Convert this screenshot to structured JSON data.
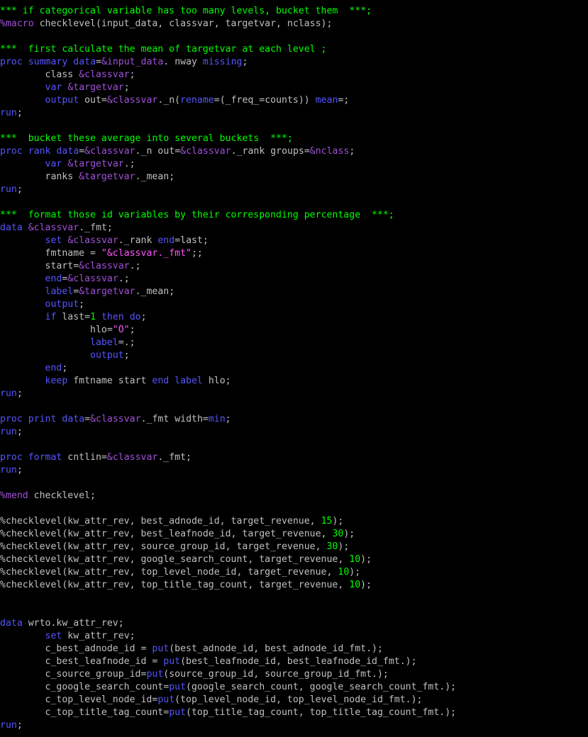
{
  "editor": {
    "colors": {
      "default": "#c0c0c0",
      "comment": "#00ff00",
      "keyword": "#5555ff",
      "macro": "#a050d8",
      "string": "#ff55ff",
      "number": "#00ff00"
    },
    "lines": [
      [
        [
          "c",
          "*** if categorical variable has too many levels, bucket them  ***;"
        ]
      ],
      [
        [
          "m",
          "%macro"
        ],
        [
          "t",
          " checklevel(input_data, classvar, targetvar, nclass);"
        ]
      ],
      [],
      [
        [
          "c",
          "***  first calculate the mean of targetvar at each level ;"
        ]
      ],
      [
        [
          "k",
          "proc"
        ],
        [
          "t",
          " "
        ],
        [
          "k",
          "summary"
        ],
        [
          "t",
          " "
        ],
        [
          "k",
          "data"
        ],
        [
          "t",
          "="
        ],
        [
          "m",
          "&input_data"
        ],
        [
          "t",
          ". nway "
        ],
        [
          "k",
          "missing"
        ],
        [
          "t",
          ";"
        ]
      ],
      [
        [
          "t",
          "        class "
        ],
        [
          "m",
          "&classvar"
        ],
        [
          "t",
          ";"
        ]
      ],
      [
        [
          "t",
          "        "
        ],
        [
          "k",
          "var"
        ],
        [
          "t",
          " "
        ],
        [
          "m",
          "&targetvar"
        ],
        [
          "t",
          ";"
        ]
      ],
      [
        [
          "t",
          "        "
        ],
        [
          "k",
          "output"
        ],
        [
          "t",
          " out="
        ],
        [
          "m",
          "&classvar"
        ],
        [
          "t",
          "._n("
        ],
        [
          "k",
          "rename"
        ],
        [
          "t",
          "=(_freq_=counts)) "
        ],
        [
          "k",
          "mean"
        ],
        [
          "t",
          "=;"
        ]
      ],
      [
        [
          "k",
          "run"
        ],
        [
          "t",
          ";"
        ]
      ],
      [],
      [
        [
          "c",
          "***  bucket these average into several buckets  ***;"
        ]
      ],
      [
        [
          "k",
          "proc"
        ],
        [
          "t",
          " "
        ],
        [
          "k",
          "rank"
        ],
        [
          "t",
          " "
        ],
        [
          "k",
          "data"
        ],
        [
          "t",
          "="
        ],
        [
          "m",
          "&classvar"
        ],
        [
          "t",
          "._n out="
        ],
        [
          "m",
          "&classvar"
        ],
        [
          "t",
          "._rank groups="
        ],
        [
          "m",
          "&nclass"
        ],
        [
          "t",
          ";"
        ]
      ],
      [
        [
          "t",
          "        "
        ],
        [
          "k",
          "var"
        ],
        [
          "t",
          " "
        ],
        [
          "m",
          "&targetvar"
        ],
        [
          "t",
          ".;"
        ]
      ],
      [
        [
          "t",
          "        ranks "
        ],
        [
          "m",
          "&targetvar"
        ],
        [
          "t",
          "._mean;"
        ]
      ],
      [
        [
          "k",
          "run"
        ],
        [
          "t",
          ";"
        ]
      ],
      [],
      [
        [
          "c",
          "***  format those id variables by their corresponding percentage  ***;"
        ]
      ],
      [
        [
          "k",
          "data"
        ],
        [
          "t",
          " "
        ],
        [
          "m",
          "&classvar"
        ],
        [
          "t",
          "._fmt;"
        ]
      ],
      [
        [
          "t",
          "        "
        ],
        [
          "k",
          "set"
        ],
        [
          "t",
          " "
        ],
        [
          "m",
          "&classvar"
        ],
        [
          "t",
          "._rank "
        ],
        [
          "k",
          "end"
        ],
        [
          "t",
          "=last;"
        ]
      ],
      [
        [
          "t",
          "        fmtname = "
        ],
        [
          "s",
          "\"&classvar._fmt\""
        ],
        [
          "t",
          ";;"
        ]
      ],
      [
        [
          "t",
          "        start="
        ],
        [
          "m",
          "&classvar"
        ],
        [
          "t",
          ".;"
        ]
      ],
      [
        [
          "t",
          "        "
        ],
        [
          "k",
          "end"
        ],
        [
          "t",
          "="
        ],
        [
          "m",
          "&classvar"
        ],
        [
          "t",
          ".;"
        ]
      ],
      [
        [
          "t",
          "        "
        ],
        [
          "k",
          "label"
        ],
        [
          "t",
          "="
        ],
        [
          "m",
          "&targetvar"
        ],
        [
          "t",
          "._mean;"
        ]
      ],
      [
        [
          "t",
          "        "
        ],
        [
          "k",
          "output"
        ],
        [
          "t",
          ";"
        ]
      ],
      [
        [
          "t",
          "        "
        ],
        [
          "k",
          "if"
        ],
        [
          "t",
          " last="
        ],
        [
          "n",
          "1"
        ],
        [
          "t",
          " "
        ],
        [
          "k",
          "then"
        ],
        [
          "t",
          " "
        ],
        [
          "k",
          "do"
        ],
        [
          "t",
          ";"
        ]
      ],
      [
        [
          "t",
          "                hlo="
        ],
        [
          "s",
          "\"O\""
        ],
        [
          "t",
          ";"
        ]
      ],
      [
        [
          "t",
          "                "
        ],
        [
          "k",
          "label"
        ],
        [
          "t",
          "=.;"
        ]
      ],
      [
        [
          "t",
          "                "
        ],
        [
          "k",
          "output"
        ],
        [
          "t",
          ";"
        ]
      ],
      [
        [
          "t",
          "        "
        ],
        [
          "k",
          "end"
        ],
        [
          "t",
          ";"
        ]
      ],
      [
        [
          "t",
          "        "
        ],
        [
          "k",
          "keep"
        ],
        [
          "t",
          " fmtname start "
        ],
        [
          "k",
          "end"
        ],
        [
          "t",
          " "
        ],
        [
          "k",
          "label"
        ],
        [
          "t",
          " hlo;"
        ]
      ],
      [
        [
          "k",
          "run"
        ],
        [
          "t",
          ";"
        ]
      ],
      [],
      [
        [
          "k",
          "proc"
        ],
        [
          "t",
          " "
        ],
        [
          "k",
          "print"
        ],
        [
          "t",
          " "
        ],
        [
          "k",
          "data"
        ],
        [
          "t",
          "="
        ],
        [
          "m",
          "&classvar"
        ],
        [
          "t",
          "._fmt width="
        ],
        [
          "k",
          "min"
        ],
        [
          "t",
          ";"
        ]
      ],
      [
        [
          "k",
          "run"
        ],
        [
          "t",
          ";"
        ]
      ],
      [],
      [
        [
          "k",
          "proc"
        ],
        [
          "t",
          " "
        ],
        [
          "k",
          "format"
        ],
        [
          "t",
          " cntlin="
        ],
        [
          "m",
          "&classvar"
        ],
        [
          "t",
          "._fmt;"
        ]
      ],
      [
        [
          "k",
          "run"
        ],
        [
          "t",
          ";"
        ]
      ],
      [],
      [
        [
          "m",
          "%mend"
        ],
        [
          "t",
          " checklevel;"
        ]
      ],
      [],
      [
        [
          "t",
          "%checklevel(kw_attr_rev, best_adnode_id, target_revenue, "
        ],
        [
          "n",
          "15"
        ],
        [
          "t",
          ");"
        ]
      ],
      [
        [
          "t",
          "%checklevel(kw_attr_rev, best_leafnode_id, target_revenue, "
        ],
        [
          "n",
          "30"
        ],
        [
          "t",
          ");"
        ]
      ],
      [
        [
          "t",
          "%checklevel(kw_attr_rev, source_group_id, target_revenue, "
        ],
        [
          "n",
          "30"
        ],
        [
          "t",
          ");"
        ]
      ],
      [
        [
          "t",
          "%checklevel(kw_attr_rev, google_search_count, target_revenue, "
        ],
        [
          "n",
          "10"
        ],
        [
          "t",
          ");"
        ]
      ],
      [
        [
          "t",
          "%checklevel(kw_attr_rev, top_level_node_id, target_revenue, "
        ],
        [
          "n",
          "10"
        ],
        [
          "t",
          ");"
        ]
      ],
      [
        [
          "t",
          "%checklevel(kw_attr_rev, top_title_tag_count, target_revenue, "
        ],
        [
          "n",
          "10"
        ],
        [
          "t",
          ");"
        ]
      ],
      [],
      [],
      [
        [
          "k",
          "data"
        ],
        [
          "t",
          " wrto.kw_attr_rev;"
        ]
      ],
      [
        [
          "t",
          "        "
        ],
        [
          "k",
          "set"
        ],
        [
          "t",
          " kw_attr_rev;"
        ]
      ],
      [
        [
          "t",
          "        c_best_adnode_id = "
        ],
        [
          "k",
          "put"
        ],
        [
          "t",
          "(best_adnode_id, best_adnode_id_fmt.);"
        ]
      ],
      [
        [
          "t",
          "        c_best_leafnode_id = "
        ],
        [
          "k",
          "put"
        ],
        [
          "t",
          "(best_leafnode_id, best_leafnode_id_fmt.);"
        ]
      ],
      [
        [
          "t",
          "        c_source_group_id="
        ],
        [
          "k",
          "put"
        ],
        [
          "t",
          "(source_group_id, source_group_id_fmt.);"
        ]
      ],
      [
        [
          "t",
          "        c_google_search_count="
        ],
        [
          "k",
          "put"
        ],
        [
          "t",
          "(google_search_count, google_search_count_fmt.);"
        ]
      ],
      [
        [
          "t",
          "        c_top_level_node_id="
        ],
        [
          "k",
          "put"
        ],
        [
          "t",
          "(top_level_node_id, top_level_node_id_fmt.);"
        ]
      ],
      [
        [
          "t",
          "        c_top_title_tag_count="
        ],
        [
          "k",
          "put"
        ],
        [
          "t",
          "(top_title_tag_count, top_title_tag_count_fmt.);"
        ]
      ],
      [
        [
          "k",
          "run"
        ],
        [
          "t",
          ";"
        ]
      ]
    ]
  }
}
